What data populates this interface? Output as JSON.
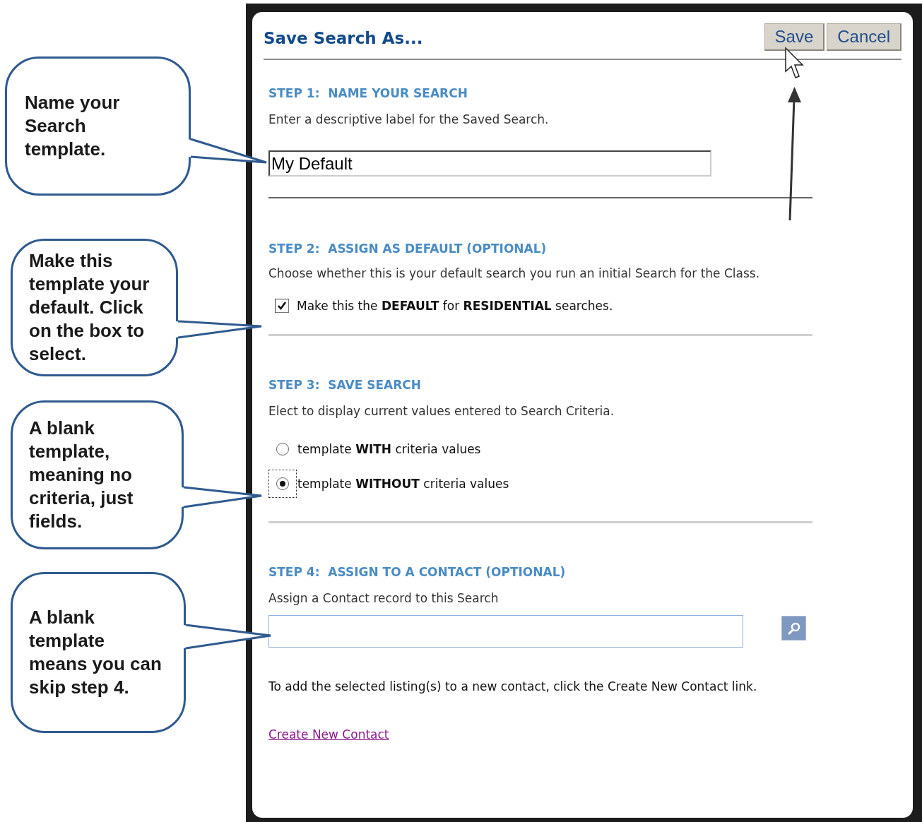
{
  "callouts": [
    {
      "lines": [
        "Name your",
        "Search",
        "template."
      ]
    },
    {
      "lines": [
        "Make this",
        "template your",
        "default. Click",
        "on the box to",
        "select."
      ]
    },
    {
      "lines": [
        "A blank",
        "template,",
        "meaning no",
        "criteria, just",
        "fields."
      ]
    },
    {
      "lines": [
        "A blank",
        "template",
        "means you can",
        "skip step 4."
      ]
    }
  ],
  "dialog": {
    "title": "Save Search As...",
    "buttons": [
      {
        "label": "Save"
      },
      {
        "label": "Cancel"
      }
    ],
    "steps": [
      {
        "kind": "name",
        "heading": "STEP 1:  NAME YOUR SEARCH",
        "description": "Enter a descriptive label for the Saved Search.",
        "field": {
          "value": "My Default"
        }
      },
      {
        "kind": "checkbox",
        "heading": "STEP 2:  ASSIGN AS DEFAULT (OPTIONAL)",
        "description": "Choose whether this is your default search you run an initial Search for the Class.",
        "checkbox": {
          "label": "Make this the **DEFAULT** for **RESIDENTIAL** searches.",
          "checked": true
        }
      },
      {
        "kind": "radio",
        "heading": "STEP 3:  SAVE SEARCH",
        "description": "Elect to display current values entered to Search Criteria.",
        "options": [
          {
            "label": "template **WITH** criteria values",
            "selected": false
          },
          {
            "label": "template **WITHOUT** criteria values",
            "selected": true
          }
        ]
      },
      {
        "kind": "contact",
        "heading": "STEP 4:  ASSIGN TO A CONTACT (OPTIONAL)",
        "description": "Assign a Contact record to this Search",
        "note": "To add the selected listing(s) to a new contact, click the Create New Contact link.",
        "link": "Create New Contact"
      }
    ]
  }
}
